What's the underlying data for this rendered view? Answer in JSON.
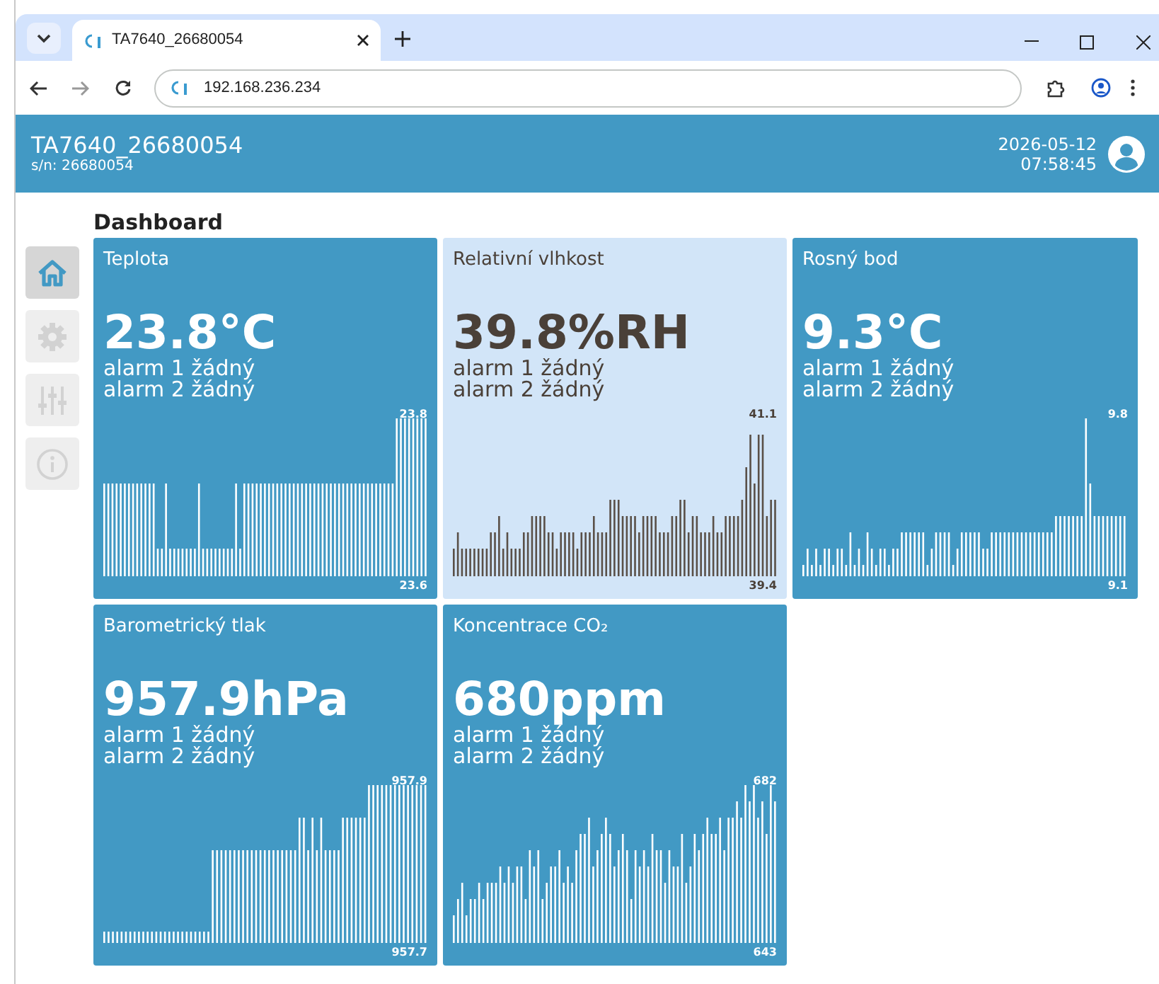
{
  "browser": {
    "tab_title": "TA7640_26680054",
    "address": "192.168.236.234"
  },
  "header": {
    "title": "TA7640_26680054",
    "serial": "s/n: 26680054",
    "date": "2026-05-12",
    "time": "07:58:45"
  },
  "page_title": "Dashboard",
  "sidebar": [
    {
      "kind": "home",
      "selected": true
    },
    {
      "kind": "settings",
      "selected": false
    },
    {
      "kind": "sliders",
      "selected": false
    },
    {
      "kind": "info",
      "selected": false
    }
  ],
  "cards": [
    {
      "title": "Teplota",
      "value": "23.8°C",
      "alarms": [
        "alarm 1 žádný",
        "alarm 2 žádný"
      ],
      "max_label": "23.8",
      "min_label": "23.6",
      "highlighted": false
    },
    {
      "title": "Relativní vlhkost",
      "value": "39.8%RH",
      "alarms": [
        "alarm 1 žádný",
        "alarm 2 žádný"
      ],
      "max_label": "41.1",
      "min_label": "39.4",
      "highlighted": true
    },
    {
      "title": "Rosný bod",
      "value": "9.3°C",
      "alarms": [
        "alarm 1 žádný",
        "alarm 2 žádný"
      ],
      "max_label": "9.8",
      "min_label": "9.1",
      "highlighted": false
    },
    {
      "title": "Barometrický tlak",
      "value": "957.9hPa",
      "alarms": [
        "alarm 1 žádný",
        "alarm 2 žádný"
      ],
      "max_label": "957.9",
      "min_label": "957.7",
      "highlighted": false
    },
    {
      "title": "Koncentrace CO₂",
      "value": "680ppm",
      "alarms": [
        "alarm 1 žádný",
        "alarm 2 žádný"
      ],
      "max_label": "682",
      "min_label": "643",
      "highlighted": false
    }
  ]
}
